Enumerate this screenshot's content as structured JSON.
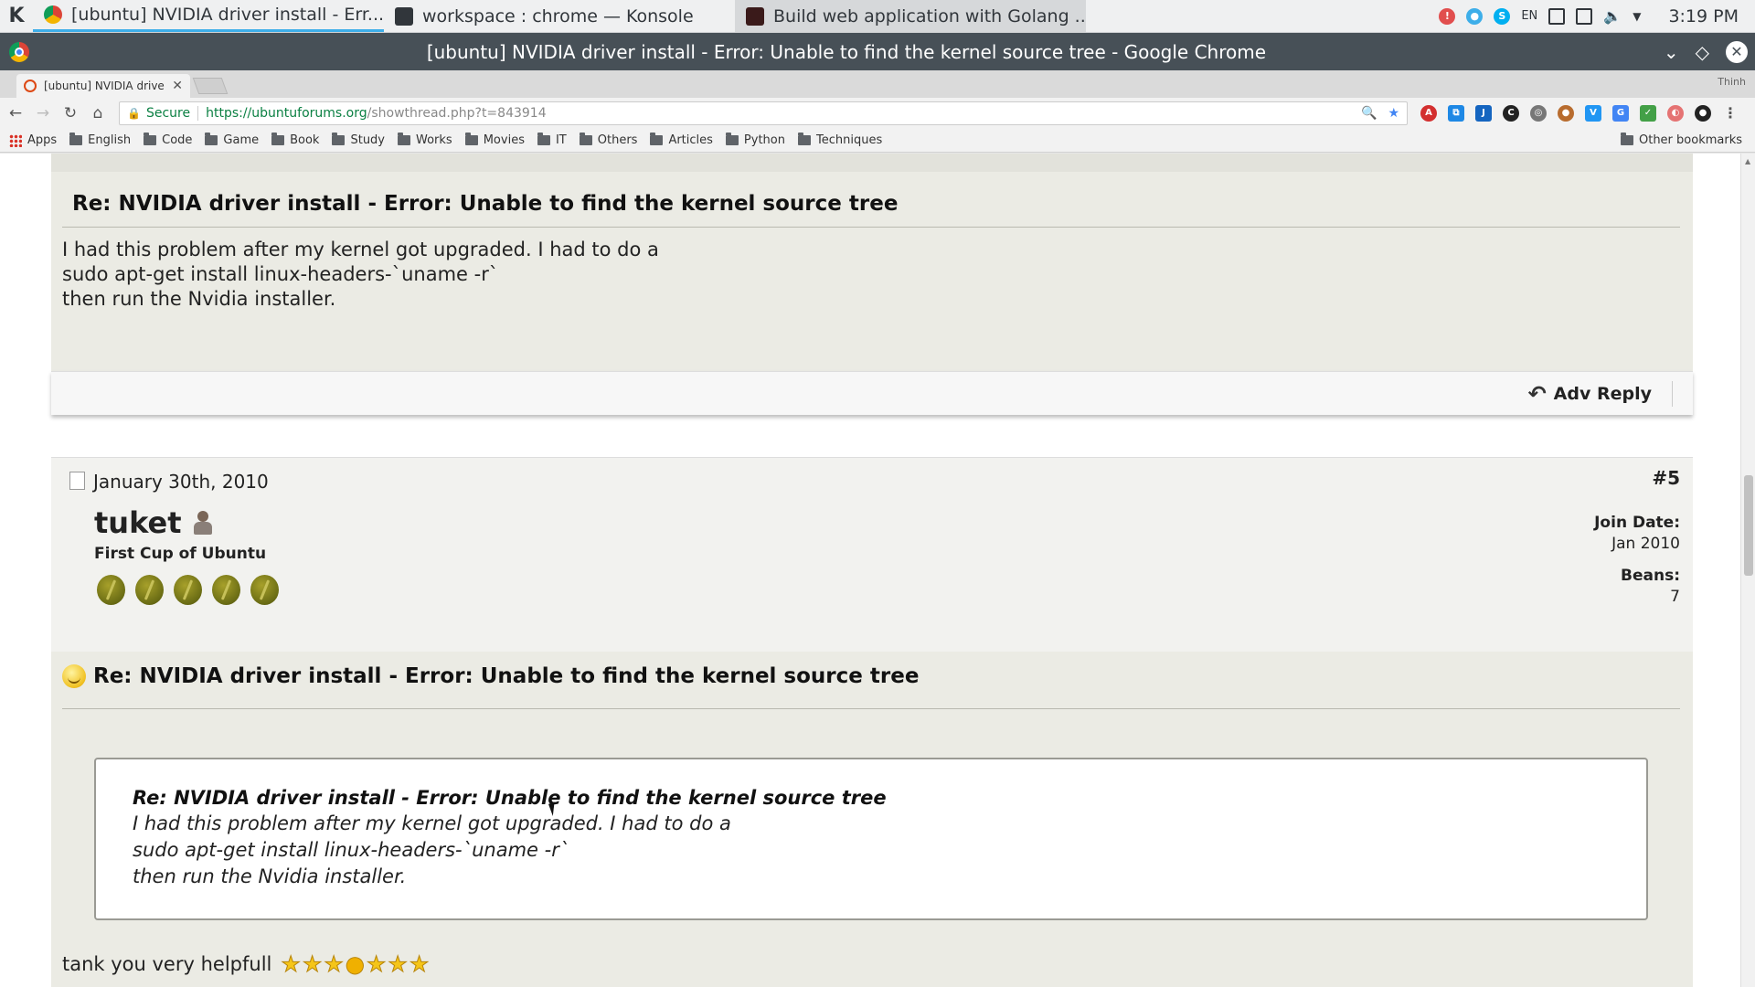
{
  "taskbar": {
    "tasks": [
      {
        "label": "[ubuntu] NVIDIA driver install - Err..."
      },
      {
        "label": "workspace : chrome — Konsole"
      },
      {
        "label": "Build web application with Golang ..."
      }
    ],
    "lang": "EN",
    "clock": "3:19 PM"
  },
  "window": {
    "title": "[ubuntu] NVIDIA driver install - Error: Unable to find the kernel source tree - Google Chrome"
  },
  "browser": {
    "tab_title": "[ubuntu] NVIDIA drive",
    "profile": "Thinh",
    "secure_label": "Secure",
    "url_host": "https://ubuntuforums.org",
    "url_path": "/showthread.php?t=843914",
    "bookmarks": [
      "Apps",
      "English",
      "Code",
      "Game",
      "Book",
      "Study",
      "Works",
      "Movies",
      "IT",
      "Others",
      "Articles",
      "Python",
      "Techniques"
    ],
    "other_bookmarks": "Other bookmarks"
  },
  "post4": {
    "title": "Re: NVIDIA driver install - Error: Unable to find the kernel source tree",
    "lines": [
      "I had this problem after my kernel got upgraded. I had to do a",
      "sudo apt-get install linux-headers-`uname -r`",
      "then run the Nvidia installer."
    ],
    "reply_label": "Adv Reply"
  },
  "post5": {
    "date": "January 30th, 2010",
    "number": "#5",
    "username": "tuket",
    "user_title": "First Cup of Ubuntu",
    "join_date_label": "Join Date:",
    "join_date": "Jan 2010",
    "beans_label": "Beans:",
    "beans": "7",
    "bean_count": 5,
    "title": "Re: NVIDIA driver install - Error: Unable to find the kernel source tree",
    "quote_title": "Re: NVIDIA driver install - Error: Unable to find the kernel source tree",
    "quote_lines": [
      "I had this problem after my kernel got upgraded. I had to do a",
      "sudo apt-get install linux-headers-`uname -r`",
      "then run the Nvidia installer."
    ],
    "reply_text": "tank you very helpfull"
  }
}
